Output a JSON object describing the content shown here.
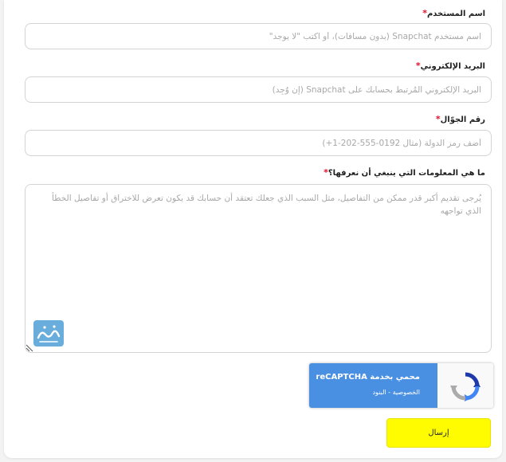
{
  "form": {
    "username": {
      "label": "اسم المستخدم",
      "required_mark": "*",
      "placeholder": "اسم مستخدم Snapchat (بدون مسافات)، أو اكتب \"لا يوجد\""
    },
    "email": {
      "label": "البريد الإلكتروني",
      "required_mark": "*",
      "placeholder": "البريد الإلكتروني المُرتبط بحسابك على Snapchat (إن وُجِد)"
    },
    "phone": {
      "label": "رقم الجوّال",
      "required_mark": "*",
      "placeholder": "أضف رمز الدولة (مثال 0192-555-202-1+)"
    },
    "details": {
      "label": "ما هي المعلومات التي ينبغي أن نعرفها؟",
      "required_mark": "*",
      "placeholder": "يُرجى تقديم أكبر قدر ممكن من التفاصيل، مثل السبب الذي جعلك تعتقد أن حسابك قد يكون تعرض للاختراق أو تفاصيل الخطأ الذي تواجهه"
    },
    "submit_label": "إرسال"
  },
  "recaptcha": {
    "prefix": "محمي بخدمة ",
    "brand": "reCAPTCHA",
    "privacy_link": "الخصوصية",
    "separator": " - ",
    "terms_link": "البنود"
  },
  "colors": {
    "accent_yellow": "#fffc00",
    "required_red": "#e0102c",
    "recaptcha_blue": "#4a90e2"
  },
  "icons": {
    "recaptcha": "recaptcha-logo-icon",
    "watermark": "site-watermark-logo",
    "resize": "resize-grip-icon"
  }
}
